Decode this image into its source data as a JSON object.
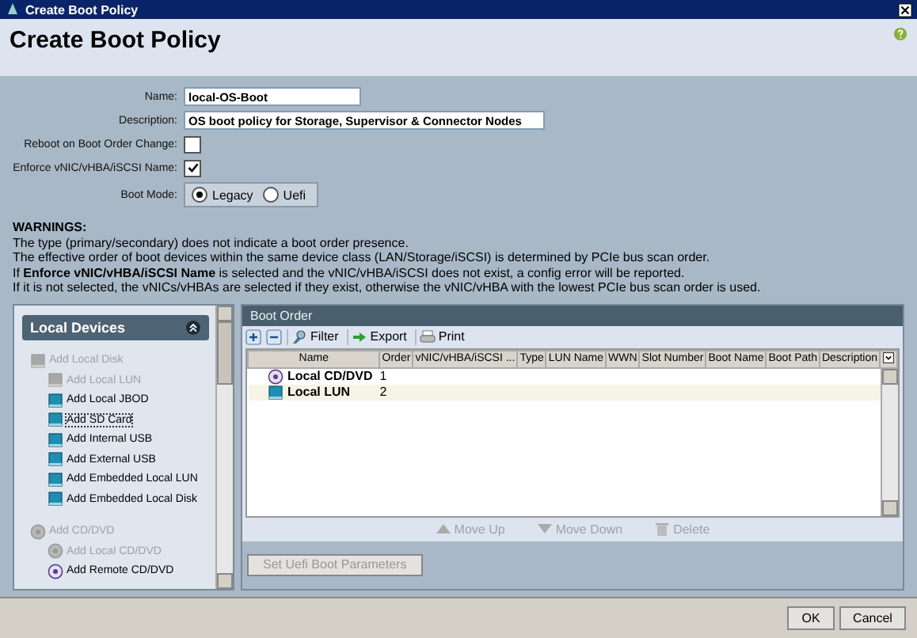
{
  "window": {
    "title": "Create Boot Policy"
  },
  "heading": "Create Boot Policy",
  "form": {
    "name": {
      "label": "Name:",
      "value": "local-OS-Boot"
    },
    "description": {
      "label": "Description:",
      "value": "OS boot policy for Storage, Supervisor & Connector Nodes"
    },
    "reboot": {
      "label": "Reboot on Boot Order Change:",
      "checked": false
    },
    "enforce": {
      "label": "Enforce vNIC/vHBA/iSCSI Name:",
      "checked": true
    },
    "boot_mode": {
      "label": "Boot Mode:",
      "options": [
        {
          "label": "Legacy",
          "selected": true
        },
        {
          "label": "Uefi",
          "selected": false
        }
      ]
    }
  },
  "warnings": {
    "title": "WARNINGS:",
    "lines": [
      "The type (primary/secondary) does not indicate a boot order presence.",
      "The effective order of boot devices within the same device class (LAN/Storage/iSCSI) is determined by PCIe bus scan order.",
      "If **Enforce vNIC/vHBA/iSCSI Name** is selected and the vNIC/vHBA/iSCSI does not exist, a config error will be reported.",
      "If it is not selected, the vNICs/vHBAs are selected if they exist, otherwise the vNIC/vHBA with the lowest PCIe bus scan order is used."
    ]
  },
  "local_devices": {
    "title": "Local Devices",
    "items": [
      {
        "label": "Add Local Disk",
        "kind": "disk",
        "disabled": true,
        "selected": false,
        "children": [
          {
            "label": "Add Local LUN",
            "kind": "disk",
            "disabled": true,
            "selected": false
          },
          {
            "label": "Add Local JBOD",
            "kind": "disk",
            "disabled": false,
            "selected": false
          },
          {
            "label": "Add SD Card",
            "kind": "disk",
            "disabled": false,
            "selected": true
          },
          {
            "label": "Add Internal USB",
            "kind": "disk",
            "disabled": false,
            "selected": false
          },
          {
            "label": "Add External USB",
            "kind": "disk",
            "disabled": false,
            "selected": false
          },
          {
            "label": "Add Embedded Local LUN",
            "kind": "disk",
            "disabled": false,
            "selected": false
          },
          {
            "label": "Add Embedded Local Disk",
            "kind": "disk",
            "disabled": false,
            "selected": false
          }
        ]
      },
      {
        "label": "Add CD/DVD",
        "kind": "cd",
        "disabled": true,
        "selected": false,
        "children": [
          {
            "label": "Add Local CD/DVD",
            "kind": "cd",
            "disabled": true,
            "selected": false
          },
          {
            "label": "Add Remote CD/DVD",
            "kind": "cd",
            "disabled": false,
            "selected": false
          }
        ]
      }
    ]
  },
  "boot_order": {
    "title": "Boot Order",
    "toolbar": [
      "Filter",
      "Export",
      "Print"
    ],
    "columns": [
      "Name",
      "Order",
      "vNIC/vHBA/iSCSI ...",
      "Type",
      "LUN Name",
      "WWN",
      "Slot Number",
      "Boot Name",
      "Boot Path",
      "Description"
    ],
    "rows": [
      {
        "name": "Local CD/DVD",
        "order": "1",
        "kind": "cd",
        "selected": false
      },
      {
        "name": "Local LUN",
        "order": "2",
        "kind": "disk",
        "selected": true
      }
    ],
    "actions": [
      {
        "label": "Move Up",
        "kind": "up",
        "disabled": true
      },
      {
        "label": "Move Down",
        "kind": "down",
        "disabled": true
      },
      {
        "label": "Delete",
        "kind": "delete",
        "disabled": true
      }
    ],
    "uefi_button": {
      "label": "Set Uefi Boot Parameters",
      "disabled": true
    }
  },
  "buttons": [
    "OK",
    "Cancel"
  ]
}
